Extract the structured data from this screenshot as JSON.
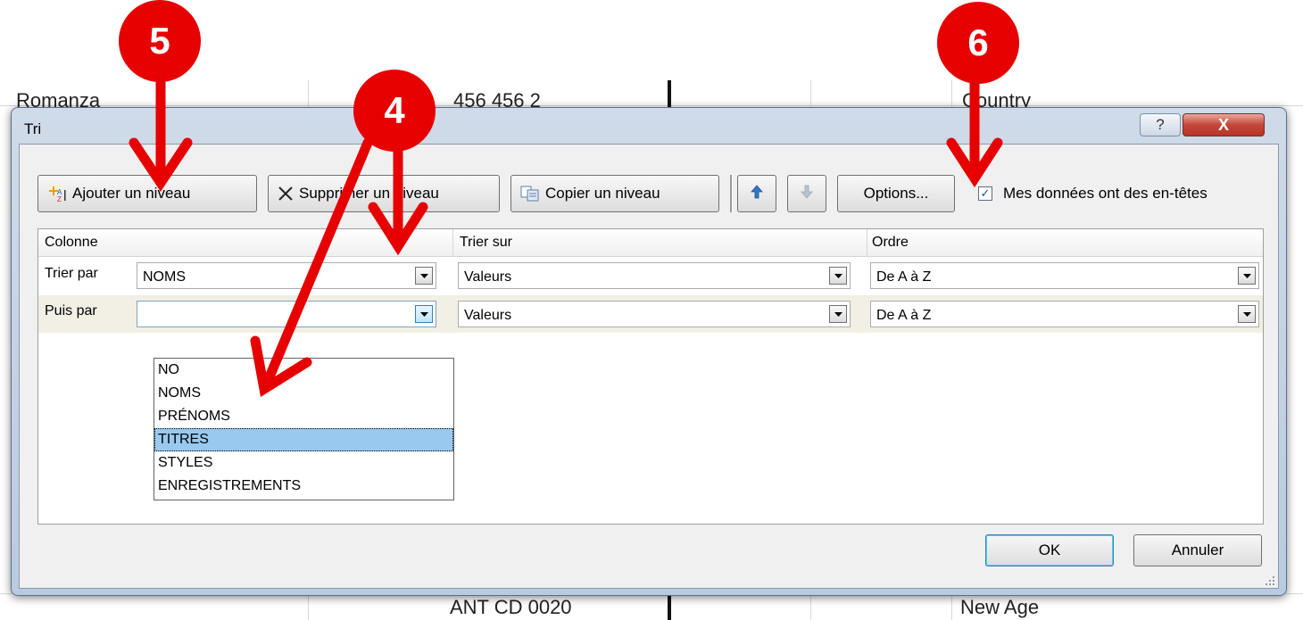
{
  "spreadsheet": {
    "top_cells": [
      "Romanza",
      "456 456 2",
      "Country"
    ],
    "bottom_cells": [
      "ANT CD 0020",
      "New Age"
    ]
  },
  "dialog": {
    "title": "Tri",
    "help_glyph": "?",
    "close_glyph": "X"
  },
  "toolbar": {
    "add_level": "Ajouter un niveau",
    "delete_level": "Supprimer un niveau",
    "copy_level": "Copier un niveau",
    "move_up_icon": "arrow-up-icon",
    "move_down_icon": "arrow-down-icon",
    "options": "Options...",
    "headers_checkbox_label": "Mes données ont des en-têtes",
    "headers_checked": true
  },
  "grid": {
    "headers": [
      "Colonne",
      "Trier sur",
      "Ordre"
    ],
    "rows": [
      {
        "label": "Trier par",
        "column": "NOMS",
        "sort_on": "Valeurs",
        "order": "De A à Z"
      },
      {
        "label": "Puis par",
        "column": "",
        "sort_on": "Valeurs",
        "order": "De A à Z"
      }
    ],
    "dropdown_options": [
      "NO",
      "NOMS",
      "PRÉNOMS",
      "TITRES",
      "STYLES",
      "ENREGISTREMENTS"
    ],
    "dropdown_highlighted": "TITRES"
  },
  "footer": {
    "ok": "OK",
    "cancel": "Annuler"
  },
  "annotations": {
    "badge_add": "5",
    "badge_dropdown": "4",
    "badge_headers": "6",
    "color": "#e60000"
  }
}
